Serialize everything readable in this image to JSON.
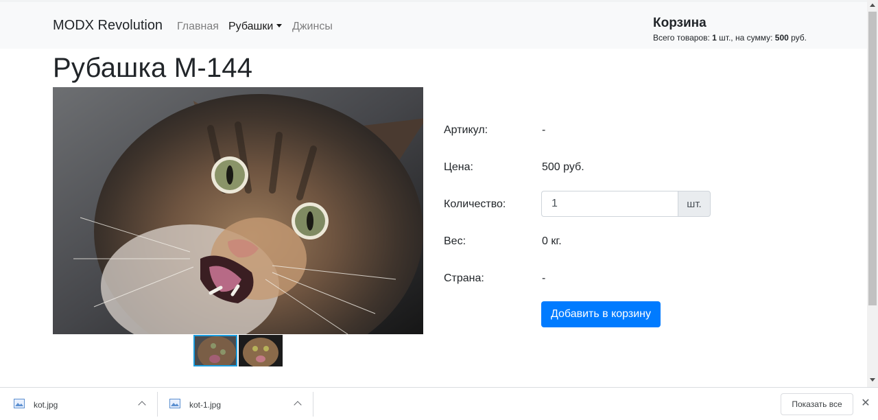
{
  "navbar": {
    "brand": "MODX Revolution",
    "links": [
      {
        "label": "Главная"
      },
      {
        "label": "Рубашки"
      },
      {
        "label": "Джинсы"
      }
    ]
  },
  "cart": {
    "title": "Корзина",
    "prefix": "Всего товаров: ",
    "count": "1",
    "mid": " шт., на сумму: ",
    "sum": "500",
    "suffix": " руб."
  },
  "product": {
    "title": "Рубашка М-144",
    "fields": [
      {
        "label": "Артикул:",
        "value": "-"
      },
      {
        "label": "Цена:",
        "value": "500 руб."
      },
      {
        "label": "Количество:"
      },
      {
        "label": "Вес:",
        "value": "0 кг."
      },
      {
        "label": "Страна:",
        "value": "-"
      }
    ],
    "quantity": "1",
    "unit": "шт.",
    "add_button": "Добавить в корзину"
  },
  "downloads": {
    "items": [
      {
        "name": "kot.jpg"
      },
      {
        "name": "kot-1.jpg"
      }
    ],
    "show_all": "Показать все"
  },
  "colors": {
    "accent": "#007bff",
    "thumb_selected": "#1a9ddf"
  }
}
